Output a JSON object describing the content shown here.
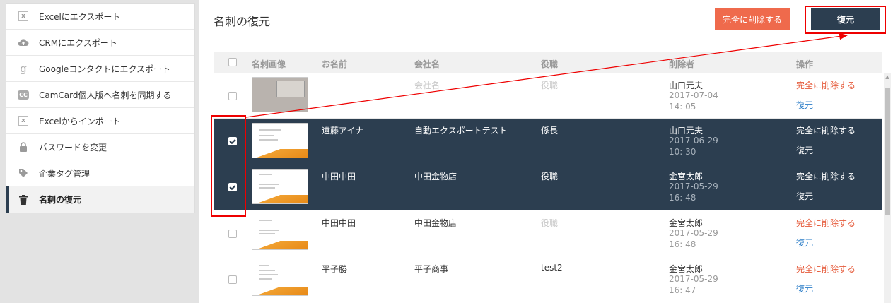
{
  "sidebar": {
    "items": [
      {
        "label": "Excelにエクスポート",
        "icon": "excel-icon"
      },
      {
        "label": "CRMにエクスポート",
        "icon": "cloud-upload-icon"
      },
      {
        "label": "Googleコンタクトにエクスポート",
        "icon": "google-icon"
      },
      {
        "label": "CamCard個人版へ名刺を同期する",
        "icon": "camcard-icon"
      },
      {
        "label": "Excelからインポート",
        "icon": "excel-icon"
      },
      {
        "label": "パスワードを変更",
        "icon": "lock-icon"
      },
      {
        "label": "企業タグ管理",
        "icon": "tag-icon"
      },
      {
        "label": "名刺の復元",
        "icon": "trash-icon",
        "active": true
      }
    ]
  },
  "header": {
    "title": "名刺の復元",
    "delete_label": "完全に削除する",
    "restore_label": "復元"
  },
  "table": {
    "columns": [
      "名刺画像",
      "お名前",
      "会社名",
      "役職",
      "削除者",
      "操作"
    ],
    "rows": [
      {
        "name": "",
        "company": "会社名",
        "title": "役職",
        "deleter": "山口元夫",
        "date": "2017-07-04",
        "time": "14: 05",
        "delete": "完全に削除する",
        "restore": "復元",
        "checked": false
      },
      {
        "name": "遠藤アイナ",
        "company": "自動エクスポートテスト",
        "title": "係長",
        "deleter": "山口元夫",
        "date": "2017-06-29",
        "time": "10: 30",
        "delete": "完全に削除する",
        "restore": "復元",
        "checked": true
      },
      {
        "name": "中田中田",
        "company": "中田金物店",
        "title": "役職",
        "deleter": "金宮太郎",
        "date": "2017-05-29",
        "time": "16: 48",
        "delete": "完全に削除する",
        "restore": "復元",
        "checked": true
      },
      {
        "name": "中田中田",
        "company": "中田金物店",
        "title": "役職",
        "deleter": "金宮太郎",
        "date": "2017-05-29",
        "time": "16: 48",
        "delete": "完全に削除する",
        "restore": "復元",
        "checked": false
      },
      {
        "name": "平子勝",
        "company": "平子商事",
        "title": "test2",
        "deleter": "金宮太郎",
        "date": "2017-05-29",
        "time": "16: 47",
        "delete": "完全に削除する",
        "restore": "復元",
        "checked": false
      }
    ]
  },
  "colors": {
    "accent": "#2c3e50",
    "danger": "#ef6a4c",
    "annotation": "#e00000"
  }
}
